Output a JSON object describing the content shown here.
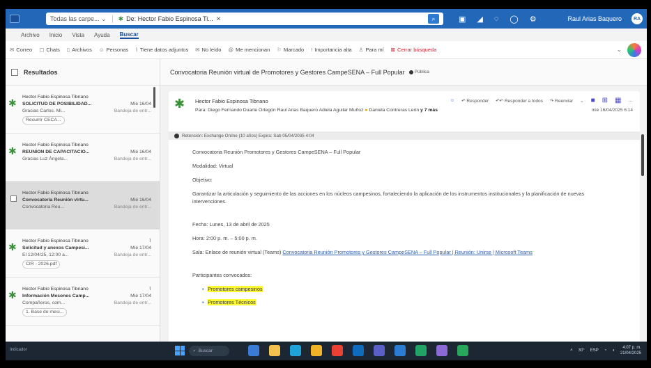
{
  "titlebar": {
    "scope": "Todas las carpe...",
    "search_chip": "De: Hector Fabio Espinosa Ti...",
    "user": "Raul Arias Baquero",
    "avatar": "RA"
  },
  "menu": [
    "Archivo",
    "Inicio",
    "Vista",
    "Ayuda",
    "Buscar"
  ],
  "ribbon": [
    "Correo",
    "Chats",
    "Archivos",
    "Personas",
    "Tiene datos adjuntos",
    "No leído",
    "Me mencionan",
    "Marcado",
    "Importancia alta",
    "Para mí",
    "Cerrar búsqueda"
  ],
  "results": {
    "title": "Resultados",
    "items": [
      {
        "from": "Hector Fabio Espinosa Tibnano",
        "subject": "SOLICITUD DE POSIBILIDAD...",
        "date": "Mié 16/04",
        "preview": "Gracias Carlos. Mi...",
        "tag": "Bandeja de entr...",
        "chip": "Recurrir CECA..."
      },
      {
        "from": "Hector Fabio Espinosa Tibnano",
        "subject": "REUNION DE CAPACITACIO...",
        "date": "Mié 16/04",
        "preview": "Gracias Luz Ángela...",
        "tag": "Bandeja de entr...",
        "chip": ""
      },
      {
        "from": "Hector Fabio Espinosa Tibnano",
        "subject": "Convocatoria Reunión virtu...",
        "date": "Mié 16/04",
        "preview": "Convocatoria Reu...",
        "tag": "Bandeja de entr...",
        "chip": ""
      },
      {
        "from": "Hector Fabio Espinosa Tibnano",
        "subject": "Solicitud y anexos Campesi...",
        "date": "Mié 17/04",
        "preview": "El 12/04/25, 12:00 a...",
        "tag": "Bandeja de entr...",
        "chip": "CIR - 2026.pdf"
      },
      {
        "from": "Hector Fabio Espinosa Tibnano",
        "subject": "Información Mesones Camp...",
        "date": "Mié 17/04",
        "preview": "Compañeros, com...",
        "tag": "Bandeja de entr...",
        "chip": "1. Base de mesi..."
      }
    ]
  },
  "message": {
    "subject": "Convocatoria Reunión virtual de Promotores y Gestores CampeSENA – Full Popular",
    "public": "Pública",
    "sender": "Hector Fabio Espinosa Tibnano",
    "to_prefix": "Para:",
    "to_list": "Diego Fernando Duarte Ortegón   Raul Arias Baquero   Adiela Aguilar Muñoz",
    "to_last": "Daniela Contreras León",
    "to_more": "y 7 más",
    "actions": [
      "Responder",
      "Responder a todos",
      "Reenviar"
    ],
    "date": "mié 16/04/2025 6:14",
    "retention": "Retención: Exchange Online (10 años) Expira: Sab 05/04/2035 4:04",
    "body": {
      "title": "Convocatoria Reunión Promotores y Gestores CampeSENA – Full Popular",
      "modalidad": "Modalidad: Virtual",
      "objetivo_label": "Objetivo:",
      "objetivo": "Garantizar la articulación y seguimiento de las acciones en los núcleos campesinos, fortaleciendo la aplicación de los instrumentos institucionales y la planificación de nuevas intervenciones.",
      "fecha": "Fecha: Lunes, 13 de abril de 2025",
      "hora": "Hora: 2:00 p. m. – 5:00 p. m.",
      "sala_prefix": "Sala: Enlace de reunión virtual (Teams)",
      "sala_link": "Convocatoria Reunión Promotores y Gestores CampeSENA – Full Popular | Reunión: Unirse | Microsoft Teams",
      "participantes": "Participantes convocados:",
      "bullets": [
        "Promotores campesinos",
        "Promotores Técnicos"
      ]
    }
  },
  "taskbar": {
    "left": "Indicador",
    "search": "Buscar",
    "temp": "30°",
    "lang": "ESP",
    "time": "4:07 p. m.",
    "date": "21/04/2025"
  }
}
